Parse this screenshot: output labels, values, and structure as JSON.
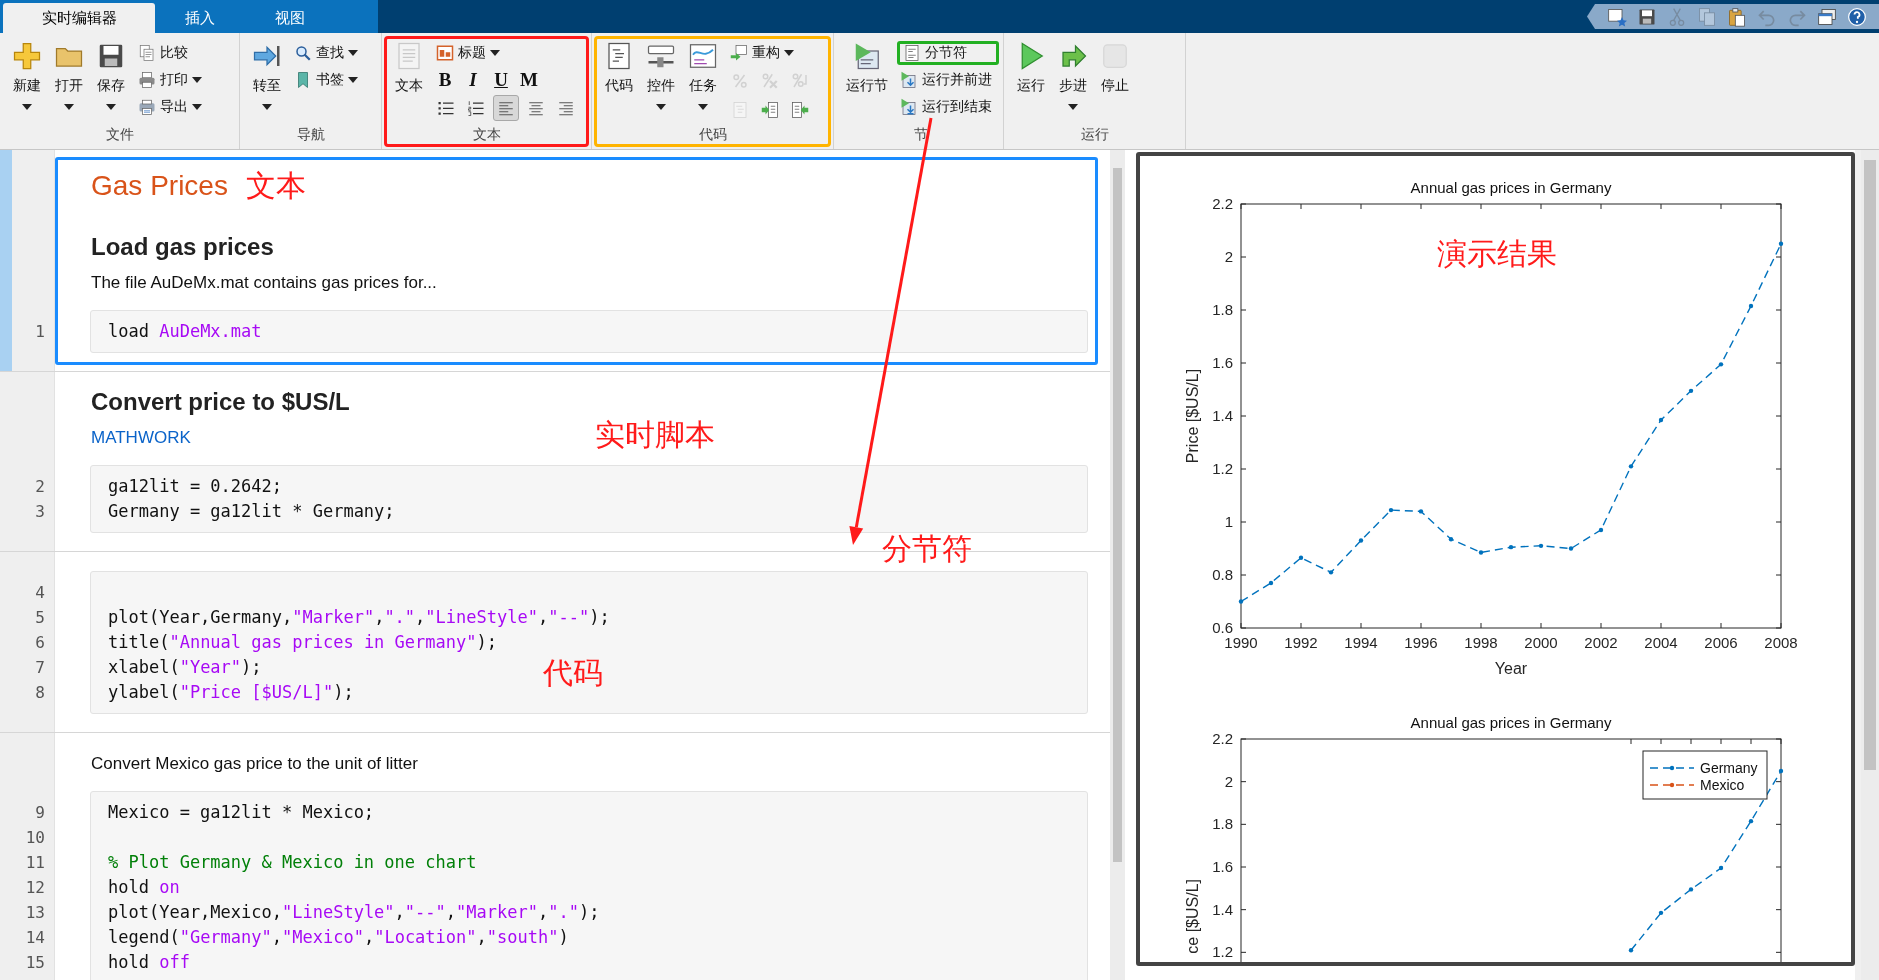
{
  "tabs": [
    {
      "label": "实时编辑器",
      "selected": true
    },
    {
      "label": "插入",
      "selected": false
    },
    {
      "label": "视图",
      "selected": false
    }
  ],
  "quick_access": [
    {
      "kind": "favorite",
      "disabled": false
    },
    {
      "kind": "save",
      "disabled": false
    },
    {
      "kind": "cut",
      "disabled": true
    },
    {
      "kind": "copy",
      "disabled": true
    },
    {
      "kind": "paste",
      "disabled": false
    },
    {
      "kind": "undo",
      "disabled": true
    },
    {
      "kind": "redo",
      "disabled": true
    },
    {
      "kind": "window",
      "disabled": false
    },
    {
      "kind": "help",
      "disabled": false
    }
  ],
  "ribbon": {
    "groups": [
      {
        "label": "文件",
        "large": [
          {
            "label": "新建",
            "kind": "new",
            "menu": true
          },
          {
            "label": "打开",
            "kind": "open",
            "menu": true
          },
          {
            "label": "保存",
            "kind": "save",
            "menu": true
          }
        ],
        "small": [
          {
            "label": "比较",
            "kind": "compare",
            "menu": false
          },
          {
            "label": "打印",
            "kind": "print",
            "menu": true
          },
          {
            "label": "导出",
            "kind": "export",
            "menu": true
          }
        ]
      },
      {
        "label": "导航",
        "large": [
          {
            "label": "转至",
            "kind": "goto",
            "menu": true
          }
        ],
        "small": [
          {
            "label": "查找",
            "kind": "find",
            "menu": true
          },
          {
            "label": "书签",
            "kind": "bookmark",
            "menu": true
          }
        ]
      },
      {
        "label": "文本",
        "color": "#ff1a1a",
        "large": [
          {
            "label": "文本",
            "kind": "text",
            "menu": false
          }
        ],
        "small": [
          {
            "label": "标题",
            "kind": "heading",
            "menu": true
          }
        ],
        "rows": [
          [
            {
              "kind": "bold",
              "label": "B",
              "selected": false
            },
            {
              "kind": "italic",
              "label": "I",
              "selected": false
            },
            {
              "kind": "underline",
              "label": "U",
              "selected": false
            },
            {
              "kind": "mono",
              "label": "M",
              "selected": false
            }
          ],
          [
            {
              "kind": "bullets",
              "selected": false
            },
            {
              "kind": "numbered",
              "selected": false
            },
            {
              "kind": "align-left",
              "selected": true
            },
            {
              "kind": "align-center",
              "selected": false
            },
            {
              "kind": "align-right",
              "selected": false
            }
          ]
        ]
      },
      {
        "label": "代码",
        "color": "#ffb400",
        "large": [
          {
            "label": "代码",
            "kind": "code",
            "menu": false
          },
          {
            "label": "控件",
            "kind": "control",
            "menu": true
          },
          {
            "label": "任务",
            "kind": "task",
            "menu": true
          }
        ],
        "small": [
          {
            "label": "重构",
            "kind": "refactor",
            "menu": true
          }
        ],
        "rows": [
          [
            {
              "kind": "comment",
              "disabled": true
            },
            {
              "kind": "uncomment",
              "disabled": true
            },
            {
              "kind": "wrap",
              "disabled": true
            }
          ],
          [
            {
              "kind": "indent-smart",
              "disabled": true
            },
            {
              "kind": "indent-in",
              "disabled": false
            },
            {
              "kind": "indent-out",
              "disabled": false
            }
          ]
        ]
      },
      {
        "label": "节",
        "large": [
          {
            "label": "运行节",
            "kind": "run-section",
            "menu": false
          }
        ],
        "small": [
          {
            "label": "分节符",
            "kind": "section-break",
            "menu": false,
            "color": "#22b022"
          },
          {
            "label": "运行并前进",
            "kind": "run-advance",
            "menu": false
          },
          {
            "label": "运行到结束",
            "kind": "run-end",
            "menu": false
          }
        ]
      },
      {
        "label": "运行",
        "large": [
          {
            "label": "运行",
            "kind": "run",
            "menu": false
          },
          {
            "label": "步进",
            "kind": "step",
            "menu": true
          },
          {
            "label": "停止",
            "kind": "stop",
            "menu": false,
            "disabled": true
          }
        ]
      }
    ]
  },
  "editor": {
    "sections": [
      {
        "selected": true,
        "blocks": [
          {
            "kind": "title",
            "text": "Gas Prices",
            "annotation": "文本"
          },
          {
            "kind": "heading",
            "text": "Load gas prices"
          },
          {
            "kind": "paragraph",
            "text": "The file AuDeMx.mat contains gas prices for..."
          },
          {
            "kind": "code",
            "lines": [
              {
                "number": "1",
                "segments": [
                  {
                    "kind": "plain",
                    "text": "load "
                  },
                  {
                    "kind": "string",
                    "text": "AuDeMx.mat"
                  }
                ]
              }
            ]
          }
        ]
      },
      {
        "selected": false,
        "annotations": [
          "实时脚本",
          "分节符"
        ],
        "blocks": [
          {
            "kind": "heading",
            "text": "Convert price to $US/L"
          },
          {
            "kind": "link",
            "text": "MATHWORK"
          },
          {
            "kind": "code",
            "lines": [
              {
                "number": "2",
                "segments": [
                  {
                    "kind": "plain",
                    "text": "ga12lit = 0.2642;"
                  }
                ]
              },
              {
                "number": "3",
                "segments": [
                  {
                    "kind": "plain",
                    "text": "Germany = ga12lit * Germany;"
                  }
                ]
              }
            ]
          }
        ]
      },
      {
        "selected": false,
        "annotations": [
          "代码"
        ],
        "blocks": [
          {
            "kind": "code",
            "lines": [
              {
                "number": "4"
              },
              {
                "number": "5",
                "segments": [
                  {
                    "kind": "plain",
                    "text": "plot(Year,Germany,"
                  },
                  {
                    "kind": "string",
                    "text": "\"Marker\""
                  },
                  {
                    "kind": "plain",
                    "text": ","
                  },
                  {
                    "kind": "string",
                    "text": "\".\""
                  },
                  {
                    "kind": "plain",
                    "text": ","
                  },
                  {
                    "kind": "string",
                    "text": "\"LineStyle\""
                  },
                  {
                    "kind": "plain",
                    "text": ","
                  },
                  {
                    "kind": "string",
                    "text": "\"--\""
                  },
                  {
                    "kind": "plain",
                    "text": ");"
                  }
                ]
              },
              {
                "number": "6",
                "segments": [
                  {
                    "kind": "plain",
                    "text": "title("
                  },
                  {
                    "kind": "string",
                    "text": "\"Annual gas prices in Germany\""
                  },
                  {
                    "kind": "plain",
                    "text": ");"
                  }
                ]
              },
              {
                "number": "7",
                "segments": [
                  {
                    "kind": "plain",
                    "text": "xlabel("
                  },
                  {
                    "kind": "string",
                    "text": "\"Year\""
                  },
                  {
                    "kind": "plain",
                    "text": ");"
                  }
                ]
              },
              {
                "number": "8",
                "segments": [
                  {
                    "kind": "plain",
                    "text": "ylabel("
                  },
                  {
                    "kind": "string",
                    "text": "\"Price [$US/L]\""
                  },
                  {
                    "kind": "plain",
                    "text": ");"
                  }
                ]
              }
            ]
          }
        ]
      },
      {
        "selected": false,
        "blocks": [
          {
            "kind": "paragraph",
            "text": "Convert Mexico gas price to the unit of litter"
          },
          {
            "kind": "code",
            "lines": [
              {
                "number": "9",
                "segments": [
                  {
                    "kind": "plain",
                    "text": "Mexico = ga12lit * Mexico;"
                  }
                ]
              },
              {
                "number": "10"
              },
              {
                "number": "11",
                "segments": [
                  {
                    "kind": "comment",
                    "text": "% Plot Germany & Mexico in one chart"
                  }
                ]
              },
              {
                "number": "12",
                "segments": [
                  {
                    "kind": "plain",
                    "text": "hold "
                  },
                  {
                    "kind": "string",
                    "text": "on"
                  }
                ]
              },
              {
                "number": "13",
                "segments": [
                  {
                    "kind": "plain",
                    "text": "plot(Year,Mexico,"
                  },
                  {
                    "kind": "string",
                    "text": "\"LineStyle\""
                  },
                  {
                    "kind": "plain",
                    "text": ","
                  },
                  {
                    "kind": "string",
                    "text": "\"--\""
                  },
                  {
                    "kind": "plain",
                    "text": ","
                  },
                  {
                    "kind": "string",
                    "text": "\"Marker\""
                  },
                  {
                    "kind": "plain",
                    "text": ","
                  },
                  {
                    "kind": "string",
                    "text": "\".\""
                  },
                  {
                    "kind": "plain",
                    "text": ");"
                  }
                ]
              },
              {
                "number": "14",
                "segments": [
                  {
                    "kind": "plain",
                    "text": "legend("
                  },
                  {
                    "kind": "string",
                    "text": "\"Germany\""
                  },
                  {
                    "kind": "plain",
                    "text": ","
                  },
                  {
                    "kind": "string",
                    "text": "\"Mexico\""
                  },
                  {
                    "kind": "plain",
                    "text": ","
                  },
                  {
                    "kind": "string",
                    "text": "\"Location\""
                  },
                  {
                    "kind": "plain",
                    "text": ","
                  },
                  {
                    "kind": "string",
                    "text": "\"south\""
                  },
                  {
                    "kind": "plain",
                    "text": ")"
                  }
                ]
              },
              {
                "number": "15",
                "segments": [
                  {
                    "kind": "plain",
                    "text": "hold "
                  },
                  {
                    "kind": "string",
                    "text": "off"
                  }
                ]
              }
            ]
          }
        ]
      }
    ]
  },
  "output": {
    "charts": [
      {
        "annotation": "演示结果",
        "chart_data": {
          "type": "line",
          "title": "Annual gas prices in Germany",
          "xlabel": "Year",
          "ylabel": "Price [$US/L]",
          "x": [
            1990,
            1991,
            1992,
            1993,
            1994,
            1995,
            1996,
            1997,
            1998,
            1999,
            2000,
            2001,
            2002,
            2003,
            2004,
            2005,
            2006,
            2007,
            2008
          ],
          "series": [
            {
              "color": "#0072bd",
              "line_style": "dashed",
              "values": [
                0.7,
                0.77,
                0.865,
                0.81,
                0.93,
                1.045,
                1.04,
                0.935,
                0.885,
                0.905,
                0.91,
                0.9,
                0.97,
                1.21,
                1.385,
                1.495,
                1.595,
                1.815,
                2.05
              ]
            }
          ],
          "xlim": [
            1990,
            2008
          ],
          "ylim": [
            0.6,
            2.2
          ],
          "xticks": [
            1990,
            1992,
            1994,
            1996,
            1998,
            2000,
            2002,
            2004,
            2006,
            2008
          ],
          "yticks": [
            0.6,
            0.8,
            1,
            1.2,
            1.4,
            1.6,
            1.8,
            2,
            2.2
          ]
        }
      },
      {
        "chart_data": {
          "type": "line",
          "title": "Annual gas prices in Germany",
          "ylabel": "ce [$US/L]",
          "x": [
            2003,
            2004,
            2005,
            2006,
            2007,
            2008
          ],
          "series": [
            {
              "name": "Germany",
              "color": "#0072bd",
              "line_style": "dashed",
              "values": [
                1.21,
                1.385,
                1.495,
                1.595,
                1.815,
                2.05
              ]
            },
            {
              "name": "Mexico",
              "color": "#d95319",
              "line_style": "dashed",
              "values": [
                null,
                null,
                null,
                null,
                null,
                null
              ]
            }
          ],
          "xlim": [
            1990,
            2008
          ],
          "ylim": [
            1.15,
            2.2
          ],
          "yticks": [
            1.2,
            1.4,
            1.6,
            1.8,
            2,
            2.2
          ]
        }
      }
    ]
  }
}
